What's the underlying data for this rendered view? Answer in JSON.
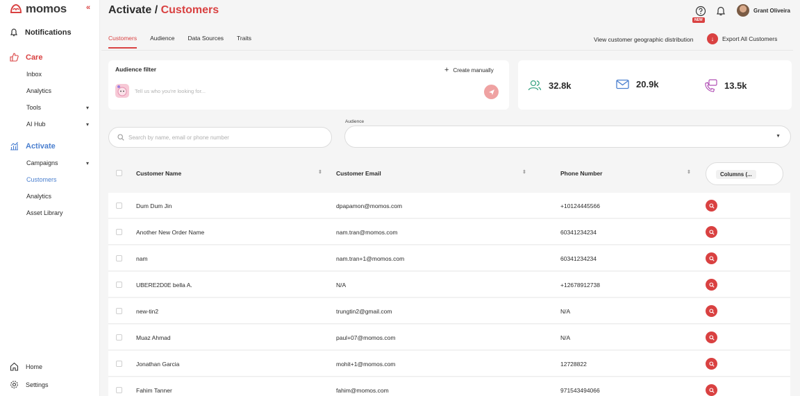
{
  "brand": {
    "name": "momos",
    "accent": "#d94141",
    "active_blue": "#4a7fcf"
  },
  "sidebar": {
    "collapse_icon": "«",
    "notifications": "Notifications",
    "care": {
      "label": "Care",
      "items": [
        {
          "label": "Inbox"
        },
        {
          "label": "Analytics"
        },
        {
          "label": "Tools",
          "chevron": "▾"
        },
        {
          "label": "AI Hub",
          "chevron": "▾"
        }
      ]
    },
    "activate": {
      "label": "Activate",
      "items": [
        {
          "label": "Campaigns",
          "chevron": "▾"
        },
        {
          "label": "Customers"
        },
        {
          "label": "Analytics"
        },
        {
          "label": "Asset Library"
        }
      ]
    },
    "home": "Home",
    "settings": "Settings"
  },
  "header": {
    "title_prefix": "Activate /",
    "title_accent": "Customers",
    "new_badge": "NEW",
    "user_name": "Grant Oliveira"
  },
  "tabs": [
    "Customers",
    "Audience",
    "Data Sources",
    "Traits"
  ],
  "actions": {
    "geo_link": "View customer geographic distribution",
    "export": "Export All Customers"
  },
  "filter": {
    "title": "Audience filter",
    "create_manually": "Create manually",
    "placeholder": "Tell us who you're looking for..."
  },
  "stats": [
    {
      "icon": "users-icon",
      "value": "32.8k"
    },
    {
      "icon": "mail-icon",
      "value": "20.9k"
    },
    {
      "icon": "phone-chat-icon",
      "value": "13.5k"
    }
  ],
  "search": {
    "placeholder": "Search by name, email or phone number"
  },
  "audience": {
    "label": "Audience"
  },
  "table": {
    "headers": {
      "name": "Customer Name",
      "email": "Customer Email",
      "phone": "Phone Number",
      "columns": "Columns (..."
    },
    "rows": [
      {
        "name": "Dum Dum Jin",
        "email": "dpapamon@momos.com",
        "phone": "+10124445566"
      },
      {
        "name": "Another New Order Name",
        "email": "nam.tran@momos.com",
        "phone": "60341234234"
      },
      {
        "name": "nam",
        "email": "nam.tran+1@momos.com",
        "phone": "60341234234"
      },
      {
        "name": "UBERE2D0E bella A.",
        "email": "N/A",
        "phone": "+12678912738"
      },
      {
        "name": "new-tin2",
        "email": "trungtin2@gmail.com",
        "phone": "N/A"
      },
      {
        "name": "Muaz Ahmad",
        "email": "paul+07@momos.com",
        "phone": "N/A"
      },
      {
        "name": "Jonathan Garcia",
        "email": "mohit+1@momos.com",
        "phone": "12728822"
      },
      {
        "name": "Fahim Tanner",
        "email": "fahim@momos.com",
        "phone": "971543494066"
      }
    ]
  }
}
